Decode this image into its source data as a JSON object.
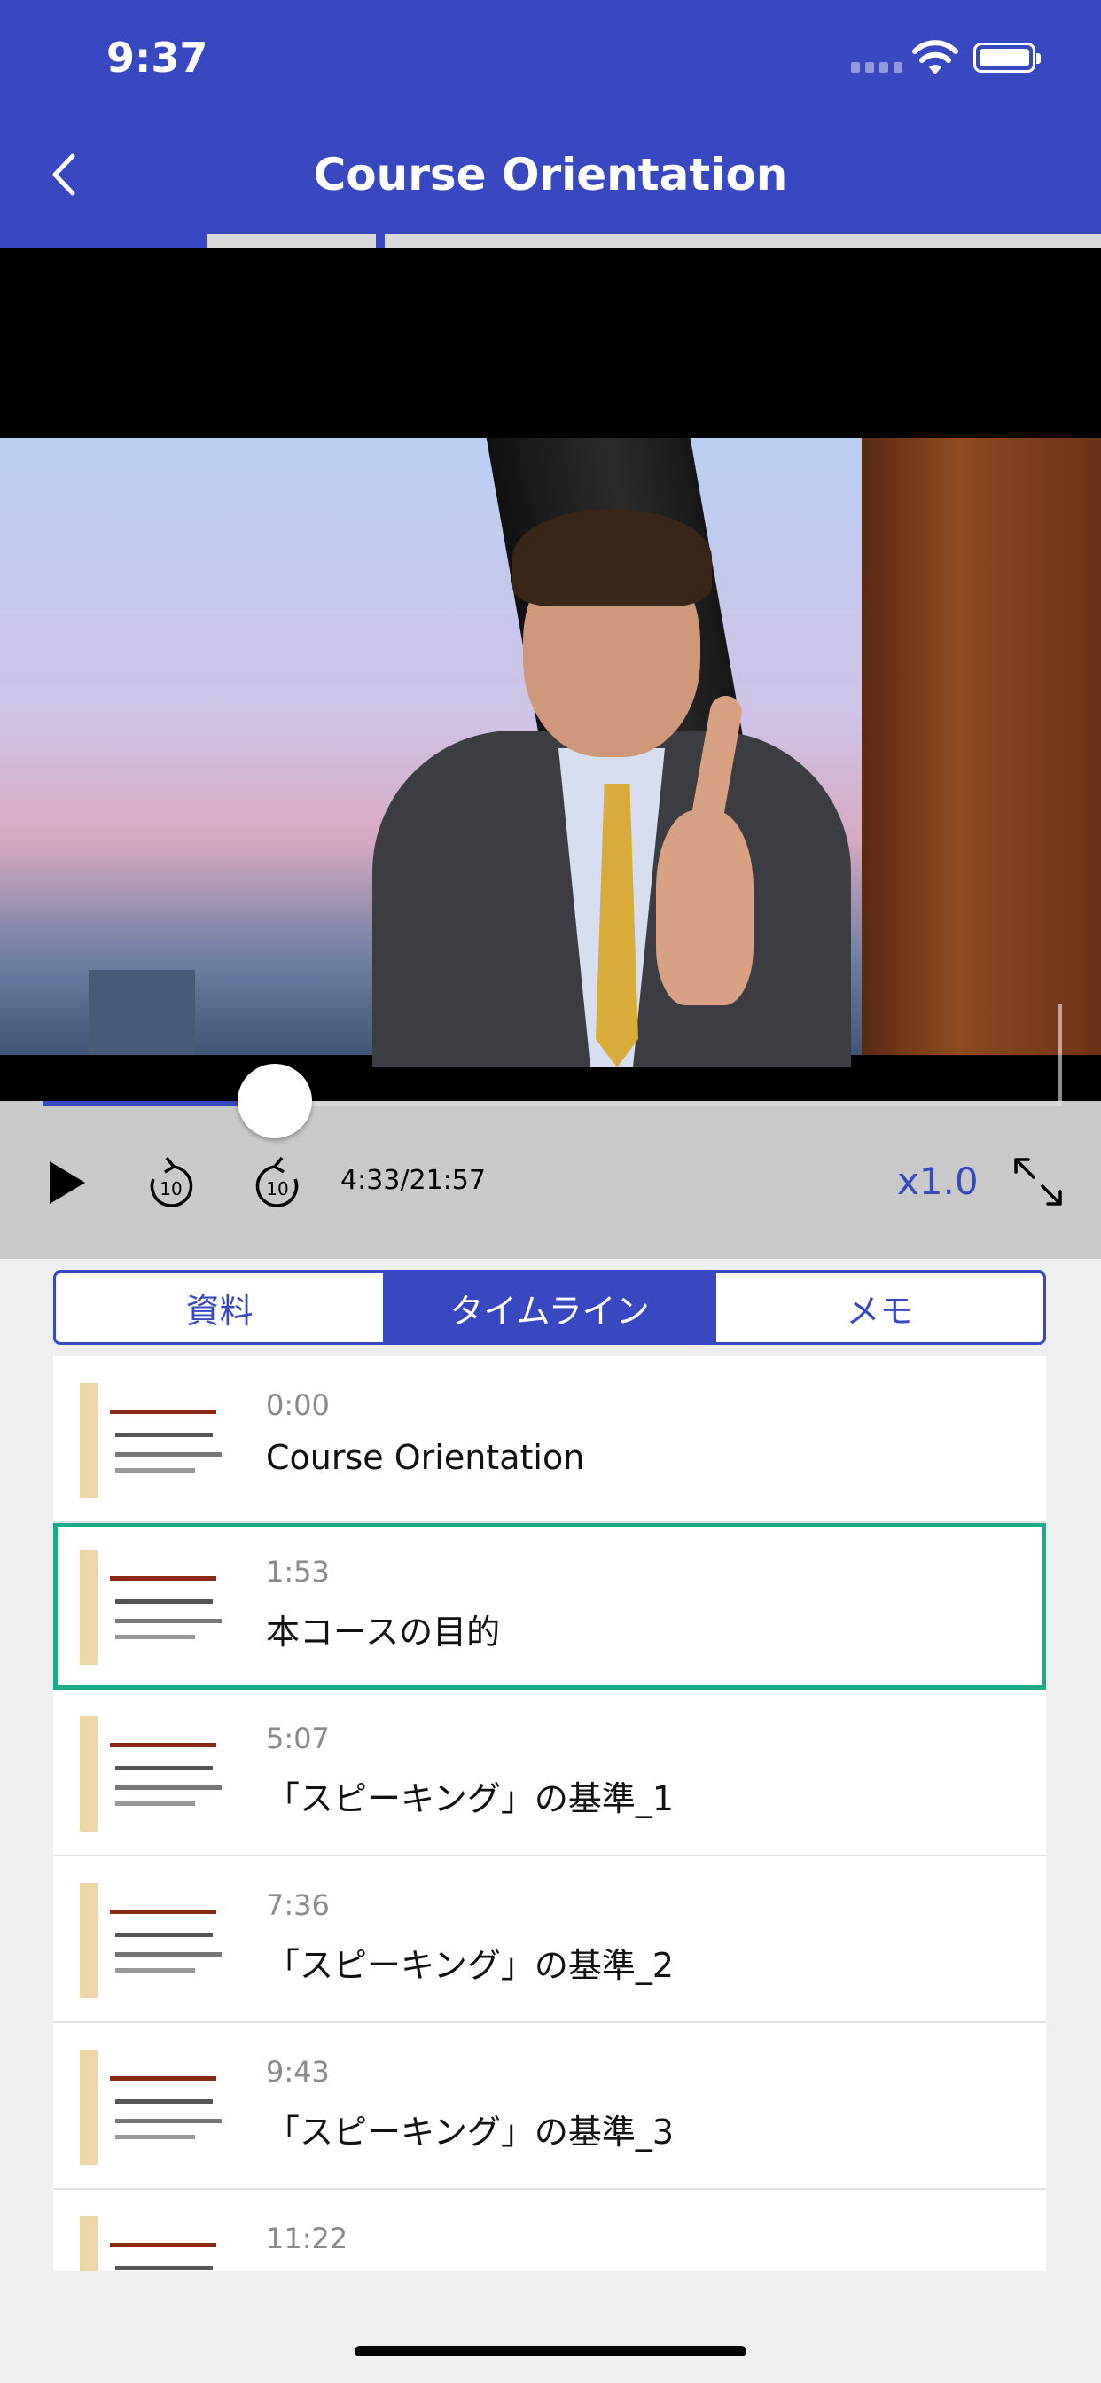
{
  "status_bar": {
    "time": "9:37"
  },
  "navbar": {
    "title": "Course Orientation",
    "back_icon": "chevron-left-icon"
  },
  "chapter_progress": {
    "segments_total": 3,
    "current_segment": 1
  },
  "player": {
    "time_text": "4:33/21:57",
    "progress_fraction": 0.207,
    "speed_label": "x1.0",
    "volume_fraction": 0.35,
    "rewind_label": "10",
    "forward_label": "10"
  },
  "tabs": [
    {
      "label": "資料",
      "active": false
    },
    {
      "label": "タイムライン",
      "active": true
    },
    {
      "label": "メモ",
      "active": false
    }
  ],
  "timeline": [
    {
      "time": "0:00",
      "title": "Course Orientation",
      "selected": false
    },
    {
      "time": "1:53",
      "title": "本コースの目的",
      "selected": true
    },
    {
      "time": "5:07",
      "title": "「スピーキング」の基準_1",
      "selected": false
    },
    {
      "time": "7:36",
      "title": "「スピーキング」の基準_2",
      "selected": false
    },
    {
      "time": "9:43",
      "title": "「スピーキング」の基準_3",
      "selected": false
    },
    {
      "time": "11:22",
      "title": "",
      "selected": false
    }
  ],
  "colors": {
    "primary": "#3748c1",
    "selected_border": "#1bab88"
  }
}
